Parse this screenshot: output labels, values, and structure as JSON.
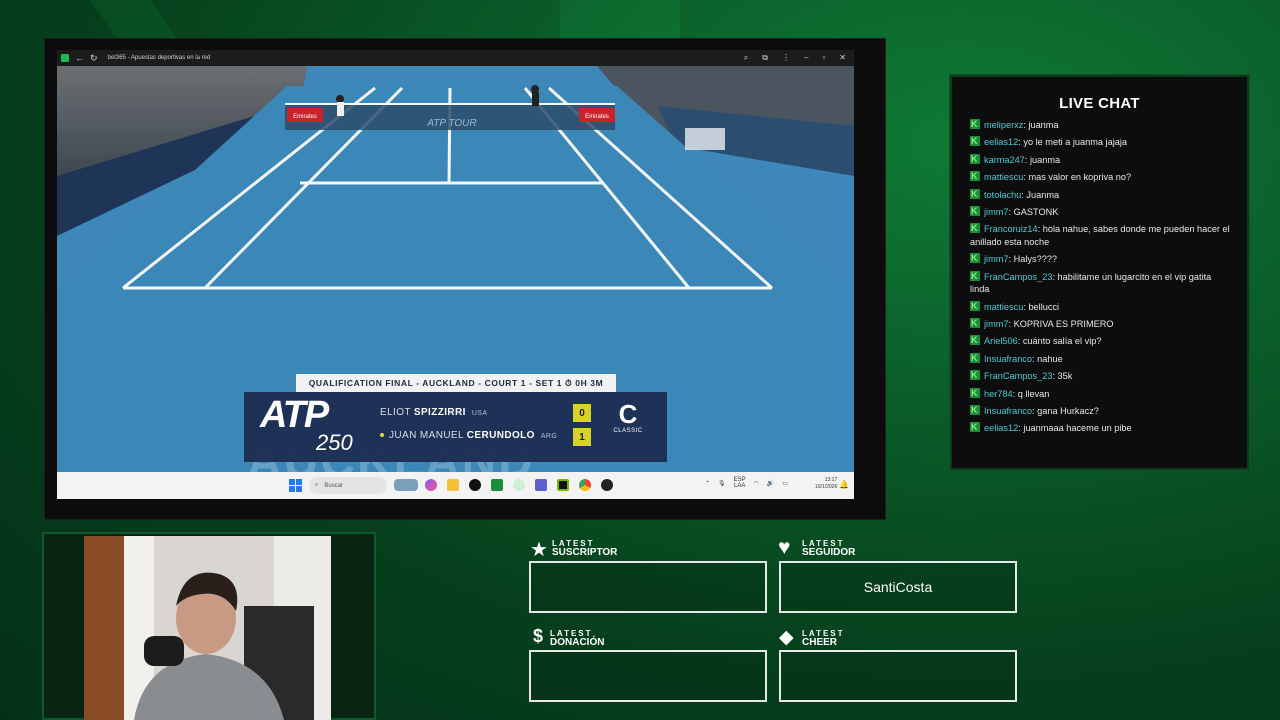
{
  "browser": {
    "tab_title": "bet365 - Apuestas deportivas en la red"
  },
  "broadcast": {
    "header": "QUALIFICATION FINAL - AUCKLAND - COURT 1 - SET 1 ⏱ 0H 3M",
    "atp": "ATP",
    "tier": "250",
    "watermark": "AUCKLAND",
    "net_text": "ATP TOUR",
    "players": [
      {
        "first": "ELIOT",
        "last": "SPIZZIRRI",
        "country": "USA",
        "score": "0"
      },
      {
        "first": "JUAN MANUEL",
        "last": "CERUNDOLO",
        "country": "ARG",
        "score": "1"
      }
    ],
    "event_logo": "C",
    "event_name": "CLASSIC",
    "ad_text": "Emirates"
  },
  "taskbar": {
    "search_placeholder": "Buscar",
    "lang": "ESP",
    "region": "LAA",
    "time": "13:17",
    "date": "10/1/2026"
  },
  "chat": {
    "title": "LIVE CHAT",
    "messages": [
      {
        "user": "meliperxz",
        "text": "juanma"
      },
      {
        "user": "eelias12",
        "text": "yo le meti a juanma jajaja"
      },
      {
        "user": "karma247",
        "text": "juanma"
      },
      {
        "user": "mattiescu",
        "text": "mas valor en kopriva no?"
      },
      {
        "user": "totolachu",
        "text": "Juanma"
      },
      {
        "user": "jimm7",
        "text": "GASTONK"
      },
      {
        "user": "Francoruiz14",
        "text": "hola nahue, sabes donde me pueden hacer el anillado esta noche"
      },
      {
        "user": "jimm7",
        "text": "Halys????"
      },
      {
        "user": "FranCampos_23",
        "text": "habilitame un lugarcito en el vip gatita linda"
      },
      {
        "user": "mattiescu",
        "text": "bellucci"
      },
      {
        "user": "jimm7",
        "text": "KOPRIVA ES PRIMERO"
      },
      {
        "user": "Ariel506",
        "text": "cuánto salía el vip?"
      },
      {
        "user": "Insuafranco",
        "text": "nahue"
      },
      {
        "user": "FranCampos_23",
        "text": "35k"
      },
      {
        "user": "her784",
        "text": "q llevan"
      },
      {
        "user": "Insuafranco",
        "text": "gana Hurkacz?"
      },
      {
        "user": "eelias12",
        "text": "juanmaaa haceme un pibe"
      }
    ]
  },
  "alerts": {
    "subscriber": {
      "small": "LATEST",
      "big": "SUSCRIPTOR",
      "value": ""
    },
    "follower": {
      "small": "LATEST",
      "big": "SEGUIDOR",
      "value": "SantiCosta"
    },
    "donation": {
      "small": "LATEST",
      "big": "DONACIÓN",
      "value": ""
    },
    "cheer": {
      "small": "LATEST",
      "big": "CHEER",
      "value": ""
    }
  },
  "colors": {
    "accent_green": "#1db954",
    "chat_user": "#4ecbd6",
    "court": "#3b87b8"
  }
}
